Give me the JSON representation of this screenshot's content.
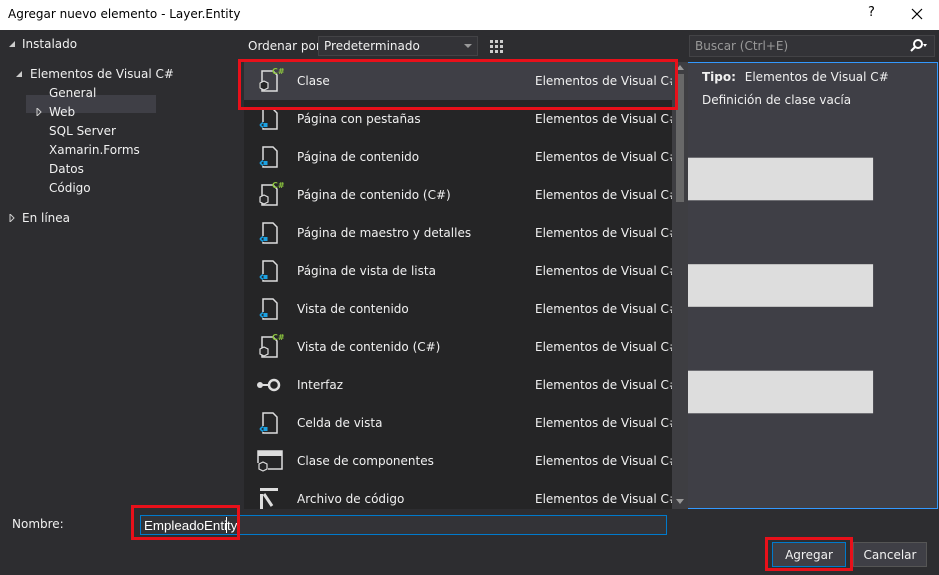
{
  "window": {
    "title": "Agregar nuevo elemento - Layer.Entity",
    "help": "?",
    "close_icon": "close-icon"
  },
  "tree": {
    "installed": "Instalado",
    "visual_cs": "Elementos de Visual C#",
    "children": [
      "General",
      "Web",
      "SQL Server",
      "Xamarin.Forms",
      "Datos",
      "Código"
    ],
    "online": "En línea"
  },
  "toolbar": {
    "sort_label": "Ordenar por:",
    "sort_value": "Predeterminado",
    "search_placeholder": "Buscar (Ctrl+E)"
  },
  "items": [
    {
      "name": "Clase",
      "category": "Elementos de Visual C#",
      "icon": "class-cs-icon"
    },
    {
      "name": "Página con pestañas",
      "category": "Elementos de Visual C#",
      "icon": "xaml-page-icon"
    },
    {
      "name": "Página de contenido",
      "category": "Elementos de Visual C#",
      "icon": "xaml-page-icon"
    },
    {
      "name": "Página de contenido (C#)",
      "category": "Elementos de Visual C#",
      "icon": "class-cs-icon"
    },
    {
      "name": "Página de maestro y detalles",
      "category": "Elementos de Visual C#",
      "icon": "xaml-page-icon"
    },
    {
      "name": "Página de vista de lista",
      "category": "Elementos de Visual C#",
      "icon": "xaml-page-icon"
    },
    {
      "name": "Vista de contenido",
      "category": "Elementos de Visual C#",
      "icon": "xaml-page-icon"
    },
    {
      "name": "Vista de contenido (C#)",
      "category": "Elementos de Visual C#",
      "icon": "class-cs-icon"
    },
    {
      "name": "Interfaz",
      "category": "Elementos de Visual C#",
      "icon": "interface-icon"
    },
    {
      "name": "Celda de vista",
      "category": "Elementos de Visual C#",
      "icon": "xaml-page-icon"
    },
    {
      "name": "Clase de componentes",
      "category": "Elementos de Visual C#",
      "icon": "component-class-icon"
    },
    {
      "name": "Archivo de código",
      "category": "Elementos de Visual C#",
      "icon": "code-file-icon"
    }
  ],
  "details": {
    "type_label": "Tipo:",
    "type_value": "Elementos de Visual C#",
    "description": "Definición de clase vacía"
  },
  "form": {
    "name_label": "Nombre:",
    "name_value": "EmpleadoEntity",
    "add_button": "Agregar",
    "cancel_button": "Cancelar"
  },
  "colors": {
    "accent": "#007acc",
    "highlight": "#e8101a",
    "icon_blue": "#1ba1e2",
    "cs_green": "#8dc63f"
  }
}
